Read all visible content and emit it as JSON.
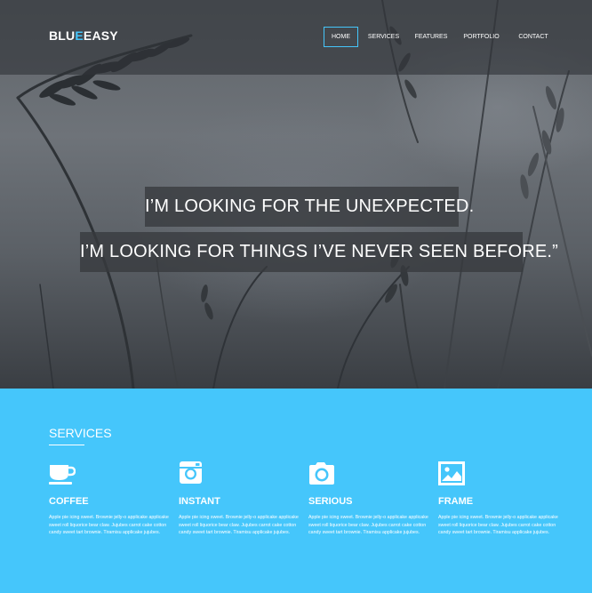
{
  "brand": {
    "logo_part1": "BLU",
    "logo_accent": "E",
    "logo_part2": "EASY"
  },
  "nav": {
    "items": [
      {
        "label": "HOME",
        "active": true
      },
      {
        "label": "SERVICES"
      },
      {
        "label": "FEATURES"
      },
      {
        "label": "PORTFOLIO"
      },
      {
        "label": "CONTACT"
      }
    ]
  },
  "hero": {
    "line1": "I’M LOOKING FOR THE UNEXPECTED.",
    "line2": "I’M LOOKING FOR THINGS I’VE NEVER SEEN BEFORE.”"
  },
  "services": {
    "title": "SERVICES",
    "items": [
      {
        "name": "COFFEE",
        "icon": "coffee-cup-icon",
        "desc": "Apple pie icing sweet. Brownie jelly-o applicake applicake sweet roll liquorice bear claw. Jujubes carrot cake cotton candy sweet tart brownie. Tiramisu applicake jujubes."
      },
      {
        "name": "INSTANT",
        "icon": "instagram-camera-icon",
        "desc": "Apple pie icing sweet. Brownie jelly-o applicake applicake sweet roll liquorice bear claw. Jujubes carrot cake cotton candy sweet tart brownie. Tiramisu applicake jujubes."
      },
      {
        "name": "SERIOUS",
        "icon": "camera-icon",
        "desc": "Apple pie icing sweet. Brownie jelly-o applicake applicake sweet roll liquorice bear claw. Jujubes carrot cake cotton candy sweet tart brownie. Tiramisu applicake jujubes."
      },
      {
        "name": "FRAME",
        "icon": "picture-frame-icon",
        "desc": "Apple pie icing sweet. Brownie jelly-o applicake applicake sweet roll liquorice bear claw. Jujubes carrot cake cotton candy sweet tart brownie. Tiramisu applicake jujubes."
      }
    ]
  },
  "colors": {
    "accent": "#45c6fb",
    "header_overlay": "#303439",
    "quote_bg": "#373a3e"
  }
}
